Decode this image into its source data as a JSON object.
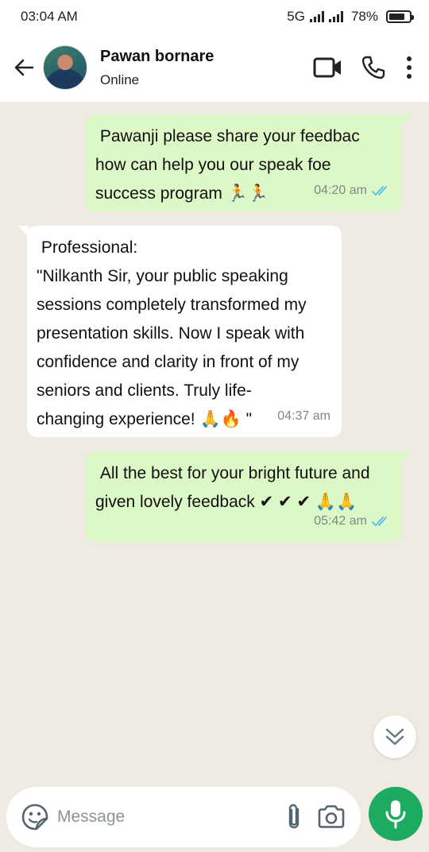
{
  "status_bar": {
    "time": "03:04 AM",
    "network": "5G",
    "battery": "78%",
    "battery_level": 0.78
  },
  "header": {
    "contact_name": "Pawan bornare",
    "contact_status": "Online",
    "icons": [
      "back-arrow-icon",
      "video-call-icon",
      "phone-icon",
      "more-vertical-icon"
    ]
  },
  "messages": [
    {
      "direction": "out",
      "text": " Pawanji please share your feedbac\nhow can help you our speak foe\nsuccess program 🏃🏃",
      "time": "04:20 am",
      "status": "read"
    },
    {
      "direction": "in",
      "text": " Professional:\n\"Nilkanth Sir, your public speaking\nsessions completely transformed my\npresentation skills. Now I speak with\nconfidence and clarity in front of my\nseniors and clients. Truly life-\nchanging experience! 🙏🔥 \"",
      "time": "04:37 am"
    },
    {
      "direction": "out",
      "text": " All the best for your bright future and\ngiven lovely feedback ✔ ✔ ✔ 🙏🙏",
      "time": "05:42 am",
      "status": "read"
    }
  ],
  "composer": {
    "placeholder": "Message",
    "icons": [
      "sticker-icon",
      "attach-icon",
      "camera-icon",
      "mic-icon"
    ]
  },
  "colors": {
    "outgoing_bubble": "#dcf8c6",
    "incoming_bubble": "#ffffff",
    "chat_background": "#efeae2",
    "read_ticks": "#53bdeb",
    "mic_button": "#1daa61"
  }
}
